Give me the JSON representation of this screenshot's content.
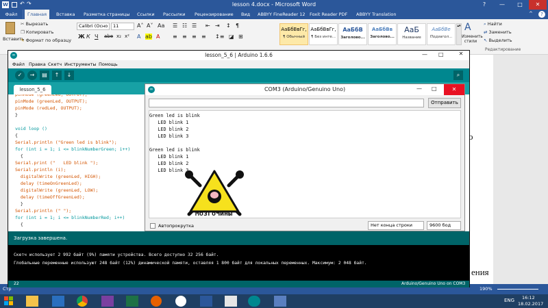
{
  "word": {
    "title": "lesson 4.docx - Microsoft Word",
    "window_controls": {
      "help": "?",
      "min": "—",
      "max": "□",
      "close": "✕"
    },
    "tabs": [
      "Файл",
      "Главная",
      "Вставка",
      "Разметка страницы",
      "Ссылки",
      "Рассылки",
      "Рецензирование",
      "Вид",
      "ABBYY FineReader 12",
      "Foxit Reader PDF",
      "ABBYY Translation"
    ],
    "active_tab": "Главная",
    "clipboard": {
      "paste": "Вставить",
      "cut": "Вырезать",
      "copy": "Копировать",
      "format_painter": "Формат по образцу"
    },
    "font": {
      "name": "Calibri (Осно",
      "size": "11"
    },
    "styles": [
      {
        "preview": "АаБбВвГг,",
        "name": "¶ Обычный"
      },
      {
        "preview": "АаБбВвГг,",
        "name": "¶ Без инте..."
      },
      {
        "preview": "АаБбВ",
        "name": "Заголово..."
      },
      {
        "preview": "АаБбВв",
        "name": "Заголово..."
      },
      {
        "preview": "АаБ",
        "name": "Название"
      },
      {
        "preview": "АаБбВе",
        "name": "Подзагол..."
      }
    ],
    "change_styles": "Изменить стили",
    "editing": {
      "find": "Найти",
      "replace": "Заменить",
      "select": "Выделить",
      "group": "Редактирование"
    },
    "doc_fragments": {
      "o": "о",
      "ending": "ения"
    },
    "status": {
      "left": "Стр",
      "zoom": "190%"
    }
  },
  "arduino": {
    "title": "lesson_5_6 | Arduino 1.6.6",
    "menu": [
      "Файл",
      "Правка",
      "Скетч",
      "Инструменты",
      "Помощь"
    ],
    "tab": "lesson_5_6",
    "code": [
      {
        "t": "pinMode (greenLed, OUTPUT);"
      },
      {
        "t": "pinMode (redLed, OUTPUT);"
      },
      {
        "t": "}"
      },
      {
        "t": ""
      },
      {
        "t": "void loop ()"
      },
      {
        "t": "{"
      },
      {
        "t": "Serial.println (\"Green led is blink\");"
      },
      {
        "t": "for (int i = 1; i <= blinkNumberGreen; i++)"
      },
      {
        "t": "  {"
      },
      {
        "t": "Serial.print (\"   LED blink \");"
      },
      {
        "t": "Serial.println (i);"
      },
      {
        "t": "  digitalWrite (greenLed, HIGH);"
      },
      {
        "t": "  delay (timeOnGreenLed);"
      },
      {
        "t": "  digitalWrite (greenLed, LOW);"
      },
      {
        "t": "  delay (timeOffGreenLed);"
      },
      {
        "t": "  }"
      },
      {
        "t": "Serial.println (\" \");"
      },
      {
        "t": "for (int i = 1; i <= blinkNumberRed; i++)"
      },
      {
        "t": "  {"
      }
    ],
    "status": "Загрузка завершена.",
    "console": [
      "Скетч использует 2 992 байт (9%) памяти устройства. Всего доступно 32 256 байт.",
      "Глобальные переменные используют 248 байт (12%) динамической памяти, оставляя 1 800 байт для локальных переменных. Максимум: 2 048 байт."
    ],
    "line_number": "22",
    "board": "Arduino/Genuino Uno on COM3"
  },
  "serial_monitor": {
    "title": "COM3 (Arduino/Genuino Uno)",
    "send_label": "Отправить",
    "input_value": "",
    "output": [
      "Green led is blink",
      "   LED blink 1",
      "   LED blink 2",
      "   LED blink 3",
      "",
      "Green led is blink",
      "   LED blink 1",
      "   LED blink 2",
      "   LED blink 3"
    ],
    "autoscroll_label": "Автопрокрутка",
    "line_ending": "Нет конца строки",
    "baud": "9600 бод",
    "watermark_text": "МозгоЧины"
  },
  "taskbar": {
    "lang": "ENG",
    "time": "16:12",
    "date": "18.02.2017"
  }
}
